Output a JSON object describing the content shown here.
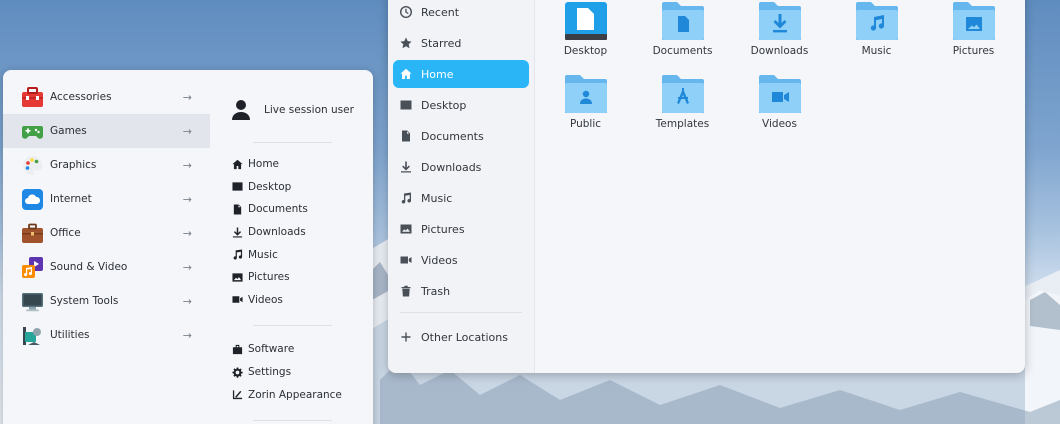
{
  "files_window": {
    "sidebar": [
      {
        "label": "Recent",
        "icon": "clock-icon"
      },
      {
        "label": "Starred",
        "icon": "star-icon"
      },
      {
        "label": "Home",
        "icon": "home-icon",
        "active": true
      },
      {
        "label": "Desktop",
        "icon": "desktop-icon"
      },
      {
        "label": "Documents",
        "icon": "document-icon"
      },
      {
        "label": "Downloads",
        "icon": "download-icon"
      },
      {
        "label": "Music",
        "icon": "music-icon"
      },
      {
        "label": "Pictures",
        "icon": "picture-icon"
      },
      {
        "label": "Videos",
        "icon": "video-icon"
      },
      {
        "label": "Trash",
        "icon": "trash-icon"
      }
    ],
    "other_locations": "Other Locations",
    "folders": [
      {
        "label": "Desktop",
        "icon": "desktop-folder-icon"
      },
      {
        "label": "Documents",
        "icon": "documents-folder-icon"
      },
      {
        "label": "Downloads",
        "icon": "downloads-folder-icon"
      },
      {
        "label": "Music",
        "icon": "music-folder-icon"
      },
      {
        "label": "Pictures",
        "icon": "pictures-folder-icon"
      },
      {
        "label": "Public",
        "icon": "public-folder-icon"
      },
      {
        "label": "Templates",
        "icon": "templates-folder-icon"
      },
      {
        "label": "Videos",
        "icon": "videos-folder-icon"
      }
    ],
    "colors": {
      "accent": "#2ab6f6",
      "folder": "#7cc6f4",
      "folder_dark": "#1e88e5"
    }
  },
  "start_menu": {
    "categories": [
      {
        "label": "Accessories",
        "icon": "toolbox-icon",
        "arrow": "→"
      },
      {
        "label": "Games",
        "icon": "gamepad-icon",
        "arrow": "→",
        "active": true
      },
      {
        "label": "Graphics",
        "icon": "palette-icon",
        "arrow": "→"
      },
      {
        "label": "Internet",
        "icon": "cloud-icon",
        "arrow": "→"
      },
      {
        "label": "Office",
        "icon": "briefcase-icon",
        "arrow": "→"
      },
      {
        "label": "Sound & Video",
        "icon": "media-icon",
        "arrow": "→"
      },
      {
        "label": "System Tools",
        "icon": "monitor-icon",
        "arrow": "→"
      },
      {
        "label": "Utilities",
        "icon": "utilities-icon",
        "arrow": "→"
      }
    ],
    "user": "Live session user",
    "places": [
      {
        "label": "Home",
        "icon": "home-icon"
      },
      {
        "label": "Desktop",
        "icon": "desktop-icon"
      },
      {
        "label": "Documents",
        "icon": "document-icon"
      },
      {
        "label": "Downloads",
        "icon": "download-icon"
      },
      {
        "label": "Music",
        "icon": "music-icon"
      },
      {
        "label": "Pictures",
        "icon": "picture-icon"
      },
      {
        "label": "Videos",
        "icon": "video-icon"
      }
    ],
    "system": [
      {
        "label": "Software",
        "icon": "software-icon"
      },
      {
        "label": "Settings",
        "icon": "gear-icon"
      },
      {
        "label": "Zorin Appearance",
        "icon": "appearance-icon"
      }
    ]
  }
}
